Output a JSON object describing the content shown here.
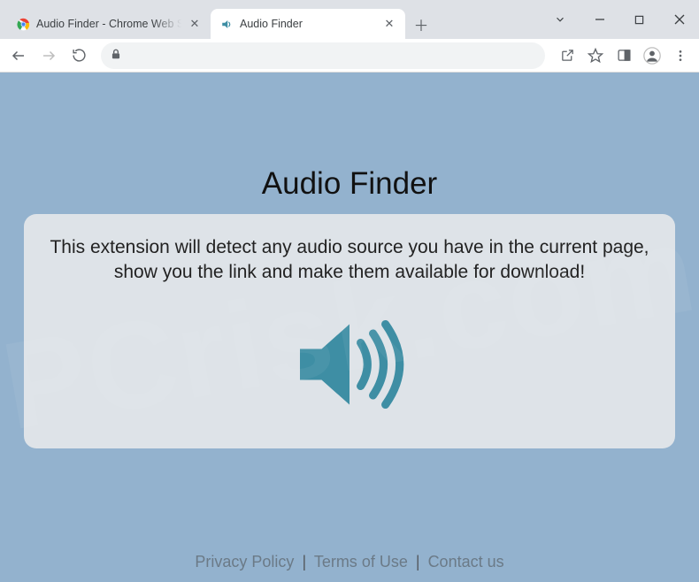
{
  "window": {
    "tabs": [
      {
        "title": "Audio Finder - Chrome Web S",
        "active": false
      },
      {
        "title": "Audio Finder",
        "active": true
      }
    ]
  },
  "page": {
    "heading": "Audio Finder",
    "description": "This extension will detect any audio source you have in the current page, show you the link and make them available for download!"
  },
  "footer": {
    "privacy": "Privacy Policy",
    "terms": "Terms of Use",
    "contact": "Contact us",
    "sep": "|"
  },
  "icons": {
    "accent": "#3e8ea4"
  }
}
